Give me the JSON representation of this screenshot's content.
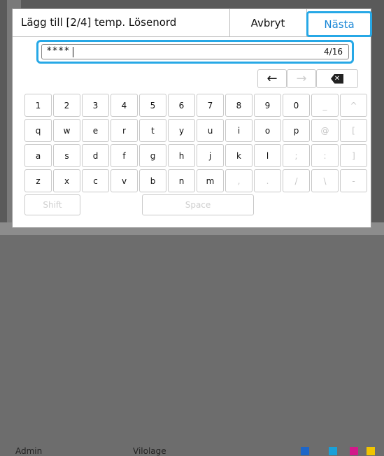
{
  "dialog": {
    "title": "Lägg till [2/4] temp. Lösenord",
    "cancel_label": "Avbryt",
    "next_label": "Nästa"
  },
  "input": {
    "value": "****",
    "count": "4/16"
  },
  "keyboard": {
    "row1": [
      "1",
      "2",
      "3",
      "4",
      "5",
      "6",
      "7",
      "8",
      "9",
      "0",
      "_",
      "^"
    ],
    "row2": [
      "q",
      "w",
      "e",
      "r",
      "t",
      "y",
      "u",
      "i",
      "o",
      "p",
      "@",
      "["
    ],
    "row3": [
      "a",
      "s",
      "d",
      "f",
      "g",
      "h",
      "j",
      "k",
      "l",
      ";",
      ":",
      "]"
    ],
    "row4": [
      "z",
      "x",
      "c",
      "v",
      "b",
      "n",
      "m",
      ",",
      ".",
      "/",
      "\\",
      "-"
    ],
    "shift_label": "Shift",
    "space_label": "Space",
    "left_arrow": "←",
    "right_arrow": "→",
    "backspace": "✕"
  },
  "background": {
    "user": "Admin",
    "mode": "Vilolage"
  }
}
